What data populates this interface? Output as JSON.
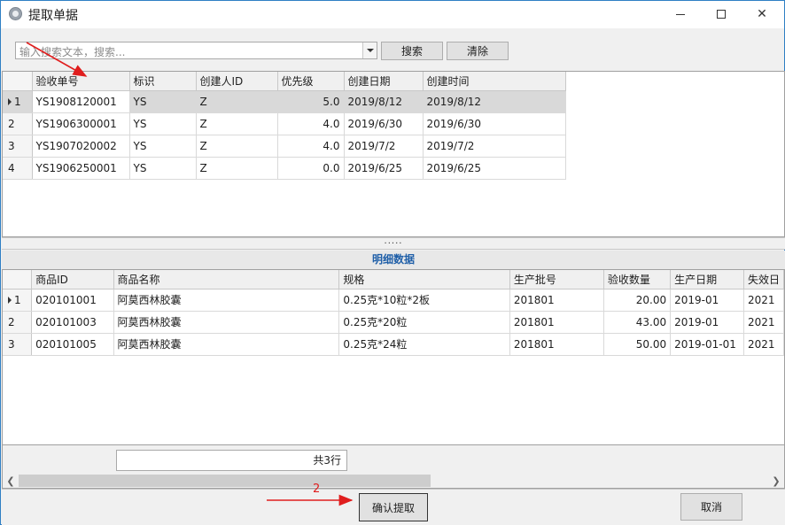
{
  "window": {
    "title": "提取单据",
    "controls": {
      "minimize": "minimize-icon",
      "maximize": "maximize-icon",
      "close": "close-icon"
    }
  },
  "search": {
    "placeholder": "输入搜索文本，搜索...",
    "value": "",
    "search_label": "搜索",
    "clear_label": "清除"
  },
  "master_grid": {
    "columns": [
      "验收单号",
      "标识",
      "创建人ID",
      "优先级",
      "创建日期",
      "创建时间"
    ],
    "rows": [
      {
        "index": "1",
        "cells": [
          "YS1908120001",
          "YS",
          "Z",
          "5.0",
          "2019/8/12",
          "2019/8/12"
        ],
        "selected": true
      },
      {
        "index": "2",
        "cells": [
          "YS1906300001",
          "YS",
          "Z",
          "4.0",
          "2019/6/30",
          "2019/6/30"
        ]
      },
      {
        "index": "3",
        "cells": [
          "YS1907020002",
          "YS",
          "Z",
          "4.0",
          "2019/7/2",
          "2019/7/2"
        ]
      },
      {
        "index": "4",
        "cells": [
          "YS1906250001",
          "YS",
          "Z",
          "0.0",
          "2019/6/25",
          "2019/6/25"
        ]
      }
    ]
  },
  "splitter": {
    "grip": "....."
  },
  "detail": {
    "title": "明细数据",
    "columns": [
      "商品ID",
      "商品名称",
      "规格",
      "生产批号",
      "验收数量",
      "生产日期",
      "失效日"
    ],
    "rows": [
      {
        "index": "1",
        "cells": [
          "020101001",
          "阿莫西林胶囊",
          "0.25克*10粒*2板",
          "201801",
          "20.00",
          "2019-01",
          "2021"
        ],
        "current": true
      },
      {
        "index": "2",
        "cells": [
          "020101003",
          "阿莫西林胶囊",
          "0.25克*20粒",
          "201801",
          "43.00",
          "2019-01",
          "2021"
        ]
      },
      {
        "index": "3",
        "cells": [
          "020101005",
          "阿莫西林胶囊",
          "0.25克*24粒",
          "201801",
          "50.00",
          "2019-01-01",
          "2021"
        ]
      }
    ],
    "row_count": "共3行",
    "scroll_fraction": 0.55
  },
  "footer": {
    "confirm_label": "确认提取",
    "cancel_label": "取消"
  },
  "annotations": {
    "step2_label": "2",
    "arrow_color": "#e01e1e"
  }
}
